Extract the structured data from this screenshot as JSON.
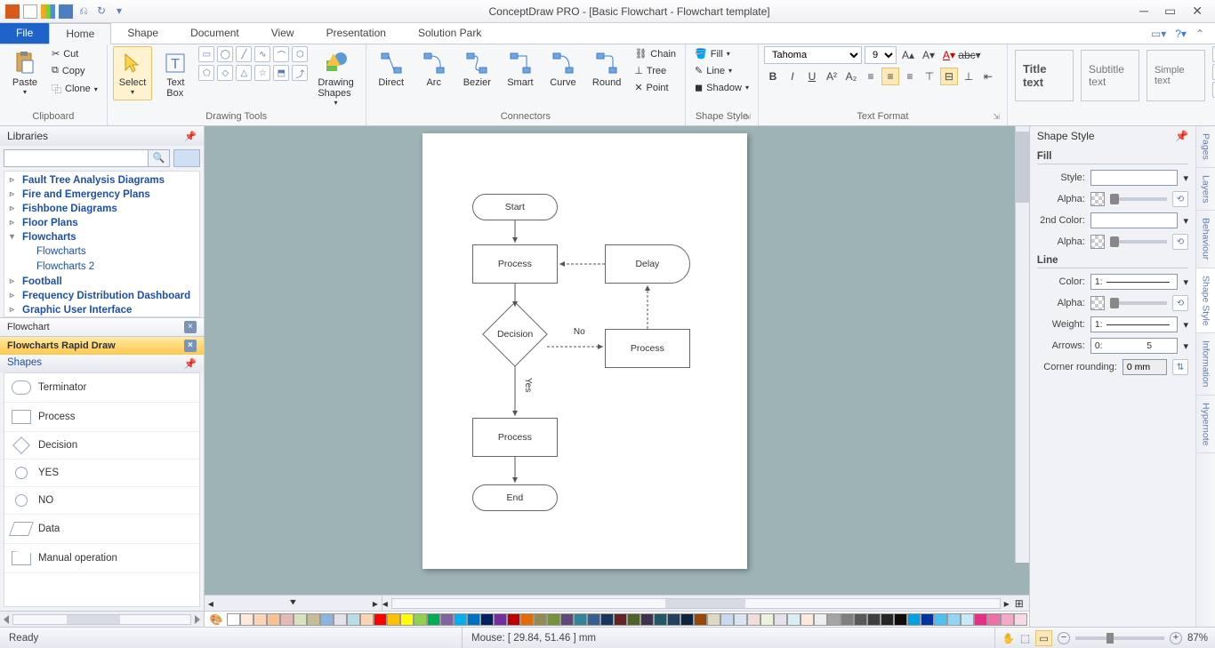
{
  "title": "ConceptDraw PRO - [Basic Flowchart - Flowchart template]",
  "tabs": {
    "file": "File",
    "home": "Home",
    "shape": "Shape",
    "document": "Document",
    "view": "View",
    "presentation": "Presentation",
    "solution": "Solution Park"
  },
  "ribbon": {
    "clipboard": {
      "label": "Clipboard",
      "paste": "Paste",
      "cut": "Cut",
      "copy": "Copy",
      "clone": "Clone"
    },
    "drawing": {
      "label": "Drawing Tools",
      "select": "Select",
      "textbox": "Text\nBox",
      "shapes": "Drawing\nShapes"
    },
    "connectors": {
      "label": "Connectors",
      "direct": "Direct",
      "arc": "Arc",
      "bezier": "Bezier",
      "smart": "Smart",
      "curve": "Curve",
      "round": "Round",
      "chain": "Chain",
      "tree": "Tree",
      "point": "Point"
    },
    "shapestyle": {
      "label": "Shape Style",
      "fill": "Fill",
      "line": "Line",
      "shadow": "Shadow"
    },
    "textformat": {
      "label": "Text Format",
      "font": "Tahoma",
      "size": "9"
    },
    "styles": {
      "title": "Title text",
      "subtitle": "Subtitle text",
      "simple": "Simple text"
    }
  },
  "libraries": {
    "title": "Libraries",
    "tree": [
      "Fault Tree Analysis Diagrams",
      "Fire and Emergency Plans",
      "Fishbone Diagrams",
      "Floor Plans",
      "Flowcharts",
      "Football",
      "Frequency Distribution Dashboard",
      "Graphic User Interface"
    ],
    "subs": [
      "Flowcharts",
      "Flowcharts 2"
    ],
    "tabs": {
      "flowchart": "Flowchart",
      "rapid": "Flowcharts Rapid Draw"
    },
    "shapeshdr": "Shapes",
    "shapes": [
      "Terminator",
      "Process",
      "Decision",
      "YES",
      "NO",
      "Data",
      "Manual operation"
    ]
  },
  "canvas": {
    "nodes": {
      "start": "Start",
      "process": "Process",
      "delay": "Delay",
      "decision": "Decision",
      "no": "No",
      "yes": "Yes",
      "end": "End"
    }
  },
  "rightpanel": {
    "title": "Shape Style",
    "fill": "Fill",
    "line": "Line",
    "style": "Style:",
    "alpha": "Alpha:",
    "color2": "2nd Color:",
    "color": "Color:",
    "weight": "Weight:",
    "arrows": "Arrows:",
    "rounding": "Corner rounding:",
    "weightval": "1:",
    "arrowsval": "0:                 5",
    "roundingval": "0 mm",
    "tabs": [
      "Pages",
      "Layers",
      "Behaviour",
      "Shape Style",
      "Information",
      "Hypernote"
    ]
  },
  "status": {
    "ready": "Ready",
    "mouse": "Mouse: [ 29.84, 51.46 ] mm",
    "zoom": "87%"
  },
  "palette": [
    "#ffffff",
    "#fde9d9",
    "#fbd5b5",
    "#fac08f",
    "#e5b9b7",
    "#d7e3bc",
    "#c4bd97",
    "#8db3e2",
    "#e5e0ec",
    "#b7dde8",
    "#fbd4b4",
    "#ff0000",
    "#ffc000",
    "#ffff00",
    "#92d050",
    "#00b050",
    "#8064a2",
    "#00b0f0",
    "#0070c0",
    "#002060",
    "#7030a0",
    "#c00000",
    "#e36c09",
    "#948a54",
    "#76923c",
    "#5f497a",
    "#31859b",
    "#366092",
    "#17365d",
    "#632423",
    "#4f6228",
    "#3f3151",
    "#205867",
    "#244061",
    "#0f243e",
    "#974806",
    "#ddd9c3",
    "#c6d9f0",
    "#dbe5f1",
    "#f2dcdb",
    "#ebf1dd",
    "#e5e0ec",
    "#dbeef3",
    "#fdeada",
    "#ededed",
    "#a5a5a5",
    "#7f7f7f",
    "#595959",
    "#3f3f3f",
    "#262626",
    "#0c0c0c",
    "#00a0e3",
    "#0033a0",
    "#4cc1ef",
    "#92d6f4",
    "#c8e9f9",
    "#e52e87",
    "#ef6fa8",
    "#f6a8c9",
    "#fad7e6"
  ]
}
